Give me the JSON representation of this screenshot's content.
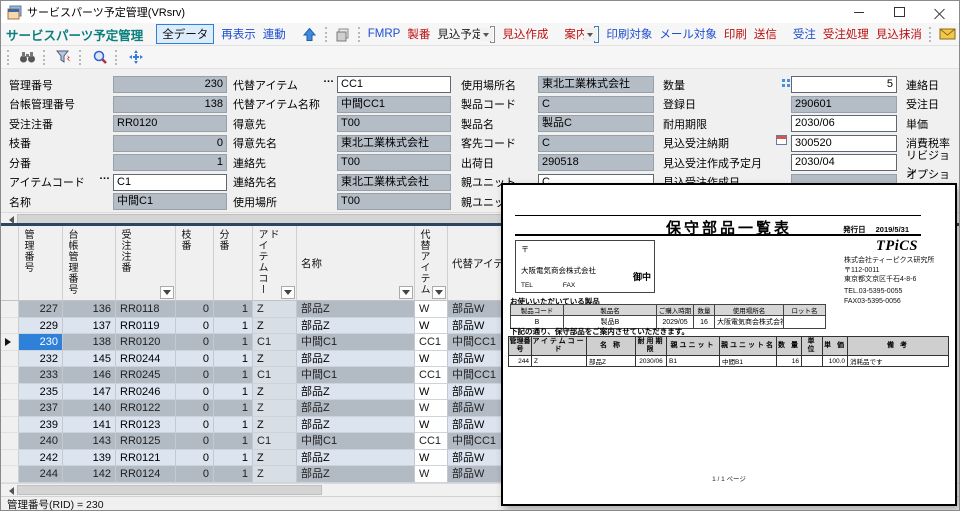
{
  "window": {
    "title": "サービスパーツ予定管理(VRsrv)"
  },
  "toolbar1": {
    "app_label": "サービスパーツ予定管理",
    "all_data": "全データ",
    "refresh": "再表示",
    "rendo": "連動",
    "fmrp": "FMRP",
    "seiban": "製番",
    "mikomi_yotei": "見込予定",
    "combo1_value": "",
    "mikomi_sakusei": "見込作成",
    "annai": "案内",
    "combo2_value": "",
    "insatsu_taisho": "印刷対象",
    "mail_taisho": "メール対象",
    "insatsu": "印刷",
    "soshin": "送信",
    "juchu": "受注",
    "juchu_shori": "受注処理",
    "mikomi_massho": "見込抹消",
    "icons": [
      "up-arrow-icon",
      "copy-icon",
      "mail-icon",
      "printer-icon"
    ]
  },
  "toolbar2": {
    "icons": [
      "binoculars-icon",
      "filter-icon",
      "search-zoom-icon",
      "move-icon"
    ]
  },
  "form": {
    "columns": [
      {
        "fields": [
          {
            "name": "kanri-bango",
            "label": "管理番号",
            "value": "230",
            "editable": false,
            "align": "right"
          },
          {
            "name": "daicho-kanri-bango",
            "label": "台帳管理番号",
            "value": "138",
            "editable": false,
            "align": "right"
          },
          {
            "name": "juchu-chuban",
            "label": "受注注番",
            "value": "RR0120",
            "editable": false,
            "align": "left"
          },
          {
            "name": "edaban",
            "label": "枝番",
            "value": "0",
            "editable": false,
            "align": "right"
          },
          {
            "name": "bunban",
            "label": "分番",
            "value": "1",
            "editable": false,
            "align": "right"
          },
          {
            "name": "item-code",
            "label": "アイテムコード",
            "value": "C1",
            "editable": true,
            "align": "left",
            "prefix": "dots"
          },
          {
            "name": "meisho",
            "label": "名称",
            "value": "中間C1",
            "editable": false,
            "align": "left"
          }
        ]
      },
      {
        "fields": [
          {
            "name": "daitai-item",
            "label": "代替アイテム",
            "value": "CC1",
            "editable": true,
            "align": "left",
            "prefix": "dots"
          },
          {
            "name": "daitai-item-meisho",
            "label": "代替アイテム名称",
            "value": "中間CC1",
            "editable": false,
            "align": "left"
          },
          {
            "name": "tokuisaki",
            "label": "得意先",
            "value": "T00",
            "editable": false,
            "align": "left"
          },
          {
            "name": "tokuisaki-mei",
            "label": "得意先名",
            "value": "東北工業株式会社",
            "editable": false,
            "align": "left"
          },
          {
            "name": "renrakusaki",
            "label": "連絡先",
            "value": "T00",
            "editable": false,
            "align": "left"
          },
          {
            "name": "renrakusaki-mei",
            "label": "連絡先名",
            "value": "東北工業株式会社",
            "editable": false,
            "align": "left"
          },
          {
            "name": "shiyo-basho",
            "label": "使用場所",
            "value": "T00",
            "editable": false,
            "align": "left"
          }
        ]
      },
      {
        "fields": [
          {
            "name": "shiyo-basho-mei",
            "label": "使用場所名",
            "value": "東北工業株式会社",
            "editable": false,
            "align": "left"
          },
          {
            "name": "seihin-code",
            "label": "製品コード",
            "value": "C",
            "editable": false,
            "align": "left"
          },
          {
            "name": "seihin-mei",
            "label": "製品名",
            "value": "製品C",
            "editable": false,
            "align": "left"
          },
          {
            "name": "kyakusaki-code",
            "label": "客先コード",
            "value": "C",
            "editable": false,
            "align": "left"
          },
          {
            "name": "shukka-bi",
            "label": "出荷日",
            "value": "290518",
            "editable": false,
            "align": "left"
          },
          {
            "name": "oya-unit",
            "label": "親ユニット",
            "value": "C",
            "editable": true,
            "align": "left"
          },
          {
            "name": "oya-unit-mei",
            "label": "親ユニット名",
            "value": "",
            "editable": false,
            "align": "left"
          }
        ]
      },
      {
        "fields": [
          {
            "name": "suryo",
            "label": "数量",
            "value": "5",
            "editable": true,
            "align": "right",
            "prefix": "grid-icon"
          },
          {
            "name": "toroku-bi",
            "label": "登録日",
            "value": "290601",
            "editable": false,
            "align": "left"
          },
          {
            "name": "taiyo-kigen",
            "label": "耐用期限",
            "value": "2030/06",
            "editable": true,
            "align": "left"
          },
          {
            "name": "mikomi-juchu-noki",
            "label": "見込受注納期",
            "value": "300520",
            "editable": true,
            "align": "left",
            "prefix": "calendar-icon"
          },
          {
            "name": "mikomi-juchu-sakusei-yotei-tsuki",
            "label": "見込受注作成予定月",
            "value": "2030/04",
            "editable": true,
            "align": "left"
          },
          {
            "name": "mikomi-juchu-sakusei-bi",
            "label": "見込受注作成日",
            "value": "",
            "editable": false,
            "align": "left"
          }
        ]
      },
      {
        "labels_only": true,
        "fields": [
          {
            "name": "renraku-bi",
            "label": "連絡日"
          },
          {
            "name": "juchu-bi",
            "label": "受注日"
          },
          {
            "name": "tanka",
            "label": "単価"
          },
          {
            "name": "shohizei-ritsu",
            "label": "消費税率"
          },
          {
            "name": "revision",
            "label": "リビジョン"
          },
          {
            "name": "option",
            "label": "オプション"
          }
        ]
      }
    ]
  },
  "grid": {
    "columns": [
      {
        "name": "col-kanri-bango",
        "label": "管理番号",
        "vertical": true,
        "align": "right",
        "filter": false
      },
      {
        "name": "col-daicho-kanri-bango",
        "label": "台帳管理番号",
        "vertical": true,
        "align": "right",
        "filter": false
      },
      {
        "name": "col-juchu-chuban",
        "label": "受注注番",
        "vertical": true,
        "align": "left",
        "filter": true
      },
      {
        "name": "col-edaban",
        "label": "枝番",
        "vertical": true,
        "align": "right",
        "filter": false
      },
      {
        "name": "col-bunban",
        "label": "分番",
        "vertical": true,
        "align": "right",
        "filter": false
      },
      {
        "name": "col-item-code",
        "label": "アイテムコード",
        "vertical": true,
        "align": "left",
        "filter": true
      },
      {
        "name": "col-meisho",
        "label": "名称",
        "vertical": false,
        "align": "left",
        "filter": true
      },
      {
        "name": "col-daitai-item",
        "label": "代替アイテム",
        "vertical": true,
        "align": "left",
        "filter": true
      },
      {
        "name": "col-daitai-item-meisho",
        "label": "代替アイテム名称",
        "vertical": false,
        "align": "left",
        "filter": false
      }
    ],
    "rows": [
      [
        "227",
        "136",
        "RR0118",
        "0",
        "1",
        "Z",
        "部品Z",
        "W",
        "部品W"
      ],
      [
        "229",
        "137",
        "RR0119",
        "0",
        "1",
        "Z",
        "部品Z",
        "W",
        "部品W"
      ],
      [
        "230",
        "138",
        "RR0120",
        "0",
        "1",
        "C1",
        "中間C1",
        "CC1",
        "中間CC1"
      ],
      [
        "232",
        "145",
        "RR0244",
        "0",
        "1",
        "Z",
        "部品Z",
        "W",
        "部品W"
      ],
      [
        "233",
        "146",
        "RR0245",
        "0",
        "1",
        "C1",
        "中間C1",
        "CC1",
        "中間CC1"
      ],
      [
        "235",
        "147",
        "RR0246",
        "0",
        "1",
        "Z",
        "部品Z",
        "W",
        "部品W"
      ],
      [
        "237",
        "140",
        "RR0122",
        "0",
        "1",
        "Z",
        "部品Z",
        "W",
        "部品W"
      ],
      [
        "239",
        "141",
        "RR0123",
        "0",
        "1",
        "Z",
        "部品Z",
        "W",
        "部品W"
      ],
      [
        "240",
        "143",
        "RR0125",
        "0",
        "1",
        "C1",
        "中間C1",
        "CC1",
        "中間CC1"
      ],
      [
        "242",
        "139",
        "RR0121",
        "0",
        "1",
        "Z",
        "部品Z",
        "W",
        "部品W"
      ],
      [
        "244",
        "142",
        "RR0124",
        "0",
        "1",
        "Z",
        "部品Z",
        "W",
        "部品W"
      ]
    ],
    "selected_row_index": 2,
    "selected_value": "230"
  },
  "statusbar": {
    "text": "管理番号(RID) = 230"
  },
  "report": {
    "title": "保守部品一覧表",
    "issue_label": "発行日",
    "issue_date": "2019/5/31",
    "logo": "TPiCS",
    "company_lines": [
      "株式会社ティーピクス研究所",
      "〒112-0011",
      "東京都文京区千石4-8-6"
    ],
    "tel": "TEL.03-5395-0055",
    "fax": "FAX03-5395-0056",
    "recipient": {
      "postal": "〒",
      "name": "大阪電気商会株式会社",
      "honorific": "御中",
      "tel_label": "TEL",
      "fax_label": "FAX"
    },
    "products_label": "お使いいただいている製品",
    "product_table": {
      "headers": [
        "製品コード",
        "製品名",
        "ご購入時期",
        "数量",
        "使用場所名",
        "ロット名"
      ],
      "rows": [
        [
          "B",
          "製品B",
          "2029/05",
          "16",
          "大阪電気商会株式会社",
          ""
        ]
      ]
    },
    "notice": "下記の通り、保守部品をご案内させていただきます。",
    "parts_table": {
      "headers": [
        "管理番号",
        "アイテムコード",
        "名 称",
        "耐用期限",
        "親ユニット",
        "親ユニット名",
        "数 量",
        "単 位",
        "単 価",
        "備 考"
      ],
      "rows": [
        [
          "244",
          "Z",
          "部品Z",
          "2030/06",
          "B1",
          "中間B1",
          "16",
          "",
          "100.0",
          "消耗品です"
        ]
      ]
    },
    "page_footer": "1 / 1 ページ"
  },
  "colors": {
    "accent_teal": "#0b7e7e",
    "link_blue": "#1d4fd0",
    "link_red": "#bb1111",
    "selected_cell": "#2e80d9",
    "row_dark": "#b2bac4",
    "row_light": "#dbe4ef"
  }
}
